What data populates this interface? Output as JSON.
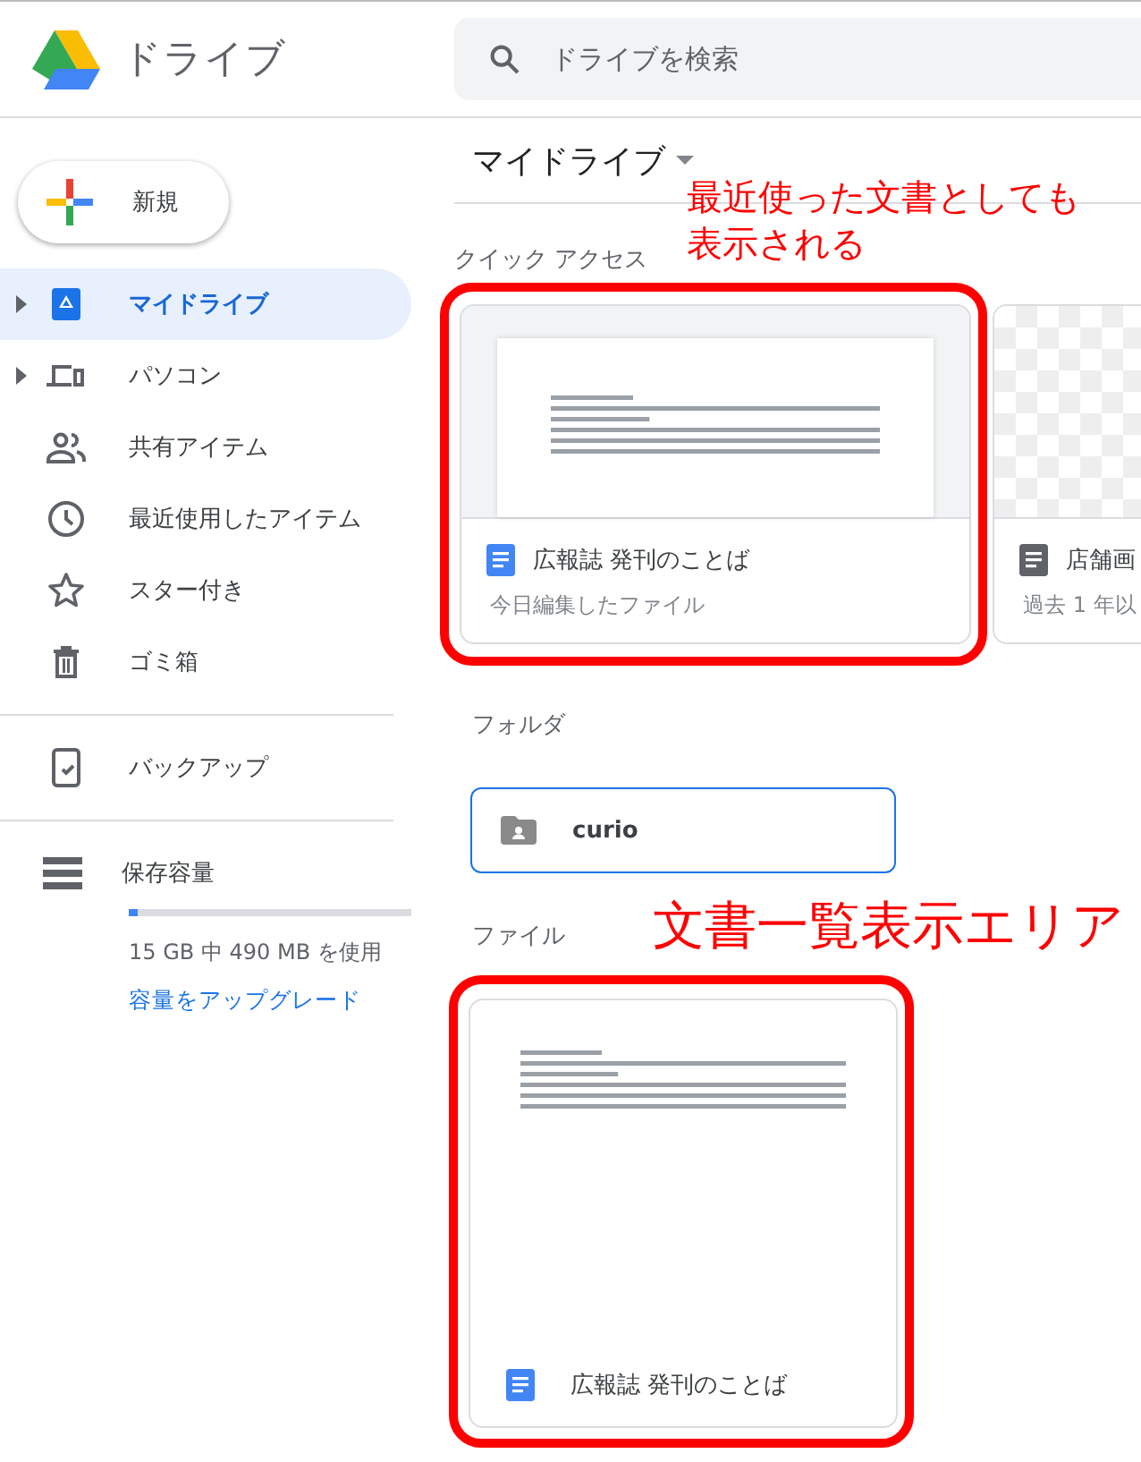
{
  "header": {
    "title": "ドライブ",
    "search": {
      "placeholder": "ドライブを検索"
    }
  },
  "new_button": {
    "label": "新規"
  },
  "sidebar": {
    "groups": [
      {
        "items": [
          {
            "label": "マイドライブ",
            "expandable": true,
            "selected": true
          },
          {
            "label": "パソコン",
            "expandable": true,
            "selected": false
          },
          {
            "label": "共有アイテム",
            "expandable": false,
            "selected": false
          },
          {
            "label": "最近使用したアイテム",
            "expandable": false,
            "selected": false
          },
          {
            "label": "スター付き",
            "expandable": false,
            "selected": false
          },
          {
            "label": "ゴミ箱",
            "expandable": false,
            "selected": false
          }
        ]
      },
      {
        "items": [
          {
            "label": "バックアップ",
            "expandable": false,
            "selected": false
          }
        ]
      }
    ],
    "storage": {
      "title": "保存容量",
      "level": 0.03,
      "usage": "15 GB 中 490 MB を使用",
      "upgrade_link": "容量をアップグレード"
    }
  },
  "main": {
    "title": "マイドライブ",
    "quick_access": {
      "heading": "クイック アクセス",
      "cards": [
        {
          "name": "広報誌 発刊のことば",
          "subtitle": "今日編集したファイル",
          "kind": "document",
          "color": "#4285f4",
          "highlighted": true
        },
        {
          "name": "店舗画",
          "subtitle": "過去 1 年以",
          "kind": "transparent",
          "color": "#5f6368",
          "highlighted": false
        }
      ]
    },
    "folders": {
      "heading": "フォルダ",
      "items": [
        {
          "name": "curio",
          "selected": true
        }
      ]
    },
    "files": {
      "heading": "ファイル",
      "items": [
        {
          "name": "広報誌 発刊のことば",
          "color": "#4285f4",
          "highlighted": true
        }
      ]
    }
  },
  "annotations": [
    {
      "text": "最近使った文書としても表示される"
    },
    {
      "text": "文書一覧表示エリア"
    }
  ]
}
